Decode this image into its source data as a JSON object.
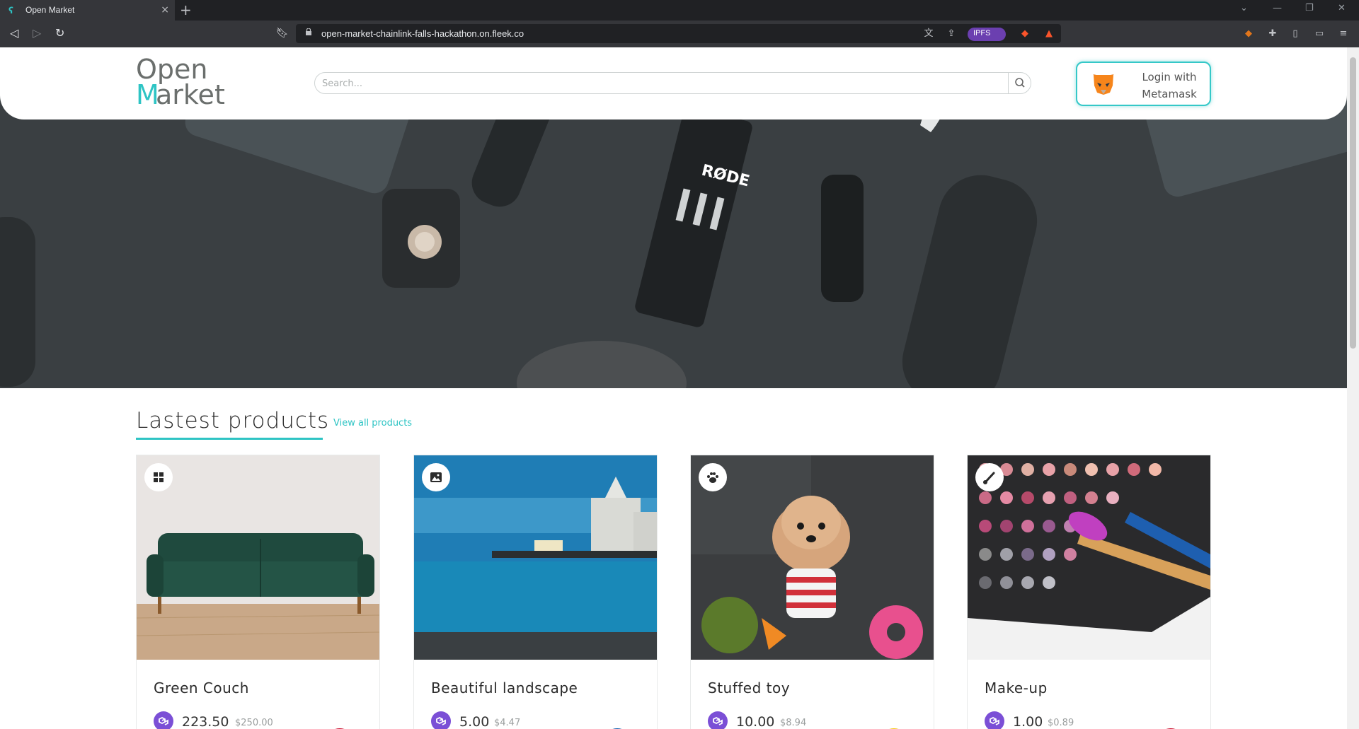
{
  "browser": {
    "tab_title": "Open Market",
    "url": "open-market-chainlink-falls-hackathon.on.fleek.co",
    "ipfs_label": "IPFS"
  },
  "header": {
    "logo_line1": "Open",
    "logo_line2": "arket",
    "logo_m": "M",
    "search_placeholder": "Search...",
    "login_label_line1": "Login with",
    "login_label_line2": "Metamask"
  },
  "products_section": {
    "title": "Lastest products",
    "view_all": "View all products",
    "items": [
      {
        "name": "Green Couch",
        "price": "223.50",
        "usd": "$250.00",
        "category_icon": "grid-icon"
      },
      {
        "name": "Beautiful landscape",
        "price": "5.00",
        "usd": "$4.47",
        "category_icon": "image-icon"
      },
      {
        "name": "Stuffed toy",
        "price": "10.00",
        "usd": "$8.94",
        "category_icon": "paw-icon"
      },
      {
        "name": "Make-up",
        "price": "1.00",
        "usd": "$0.89",
        "category_icon": "brush-icon"
      }
    ]
  },
  "colors": {
    "accent": "#2ec4c4",
    "coin": "#7b4fd6",
    "hero_bg": "#3a3f42"
  }
}
